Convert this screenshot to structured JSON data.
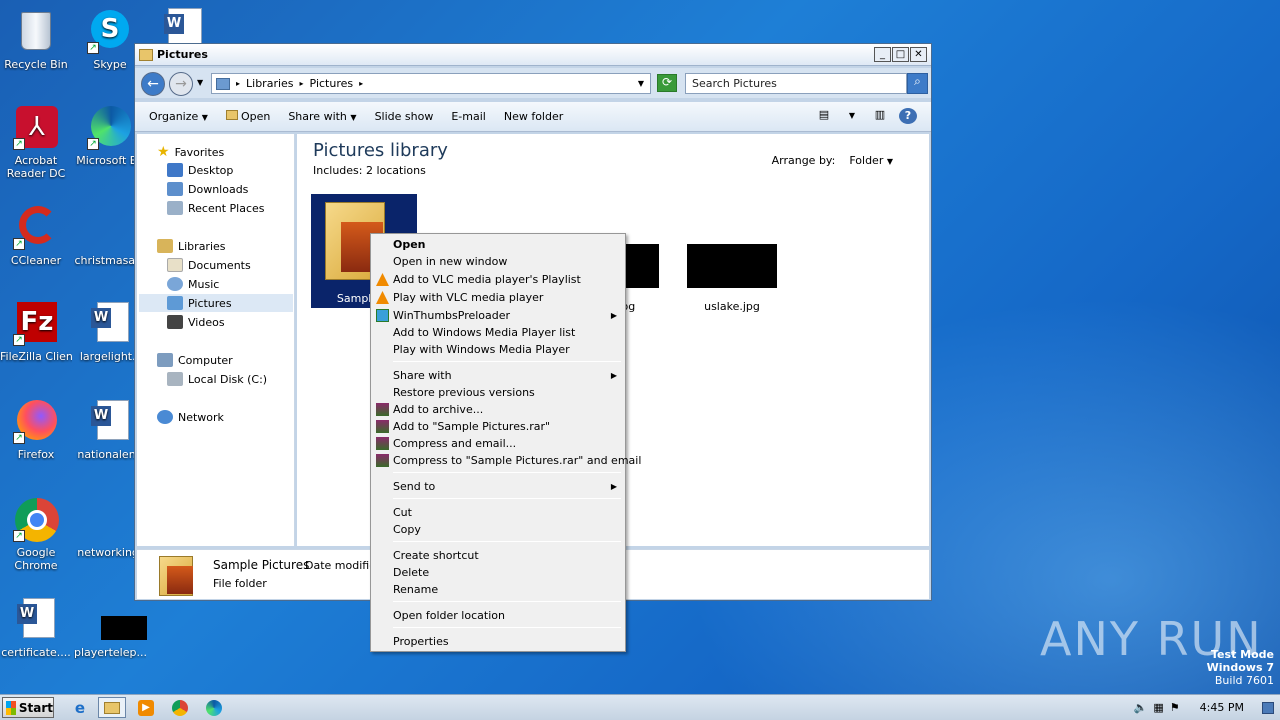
{
  "desktop": {
    "icons": [
      {
        "label": "Recycle Bin",
        "icon": "recycle-bin-icon"
      },
      {
        "label": "Skype",
        "icon": "skype-icon"
      },
      {
        "label": "Acrobat Reader DC",
        "icon": "acrobat-icon"
      },
      {
        "label": "Microsoft Ed",
        "icon": "edge-icon"
      },
      {
        "label": "CCleaner",
        "icon": "ccleaner-icon"
      },
      {
        "label": "christmasa...",
        "icon": "blank-file-icon"
      },
      {
        "label": "FileZilla Client",
        "icon": "filezilla-icon"
      },
      {
        "label": "largelight.r",
        "icon": "word-doc-icon"
      },
      {
        "label": "Firefox",
        "icon": "firefox-icon"
      },
      {
        "label": "nationalend",
        "icon": "word-doc-icon"
      },
      {
        "label": "Google Chrome",
        "icon": "chrome-icon"
      },
      {
        "label": "networkingf",
        "icon": "blank-file-icon"
      },
      {
        "label": "certificate....",
        "icon": "word-doc-icon"
      },
      {
        "label": "playertelep...",
        "icon": "black-thumb-icon"
      }
    ]
  },
  "window": {
    "title": "Pictures",
    "address": {
      "seg1": "Libraries",
      "seg2": "Pictures"
    },
    "search_placeholder": "Search Pictures",
    "toolbar": {
      "organize": "Organize",
      "open": "Open",
      "share_with": "Share with",
      "slide_show": "Slide show",
      "email": "E-mail",
      "new_folder": "New folder"
    },
    "nav": {
      "favorites": "Favorites",
      "desktop": "Desktop",
      "downloads": "Downloads",
      "recent_places": "Recent Places",
      "libraries": "Libraries",
      "documents": "Documents",
      "music": "Music",
      "pictures": "Pictures",
      "videos": "Videos",
      "computer": "Computer",
      "local_disk": "Local Disk (C:)",
      "network": "Network"
    },
    "content": {
      "title": "Pictures library",
      "includes": "Includes:  2 locations",
      "arrange_label": "Arrange by:",
      "arrange_value": "Folder",
      "files": [
        {
          "name": "Sample Pi"
        },
        {
          "name": "ge.jpg"
        },
        {
          "name": "uslake.jpg"
        }
      ]
    },
    "details": {
      "name": "Sample Pictures",
      "date_label": "Date modified",
      "type": "File folder"
    }
  },
  "context_menu": {
    "open": "Open",
    "open_new_window": "Open in new window",
    "vlc_playlist": "Add to VLC media player's Playlist",
    "vlc_play": "Play with VLC media player",
    "winthumbs": "WinThumbsPreloader",
    "wmp_list": "Add to Windows Media Player list",
    "wmp_play": "Play with Windows Media Player",
    "share_with": "Share with",
    "restore": "Restore previous versions",
    "add_archive": "Add to archive...",
    "add_rar": "Add to \"Sample Pictures.rar\"",
    "compress_email": "Compress and email...",
    "compress_rar_email": "Compress to \"Sample Pictures.rar\" and email",
    "send_to": "Send to",
    "cut": "Cut",
    "copy": "Copy",
    "create_shortcut": "Create shortcut",
    "delete": "Delete",
    "rename": "Rename",
    "open_location": "Open folder location",
    "properties": "Properties"
  },
  "taskbar": {
    "start": "Start",
    "clock": "4:45 PM"
  },
  "watermark": {
    "line1": "Test Mode",
    "line2": "Windows 7",
    "line3": "Build 7601",
    "brand": "ANY RUN"
  }
}
